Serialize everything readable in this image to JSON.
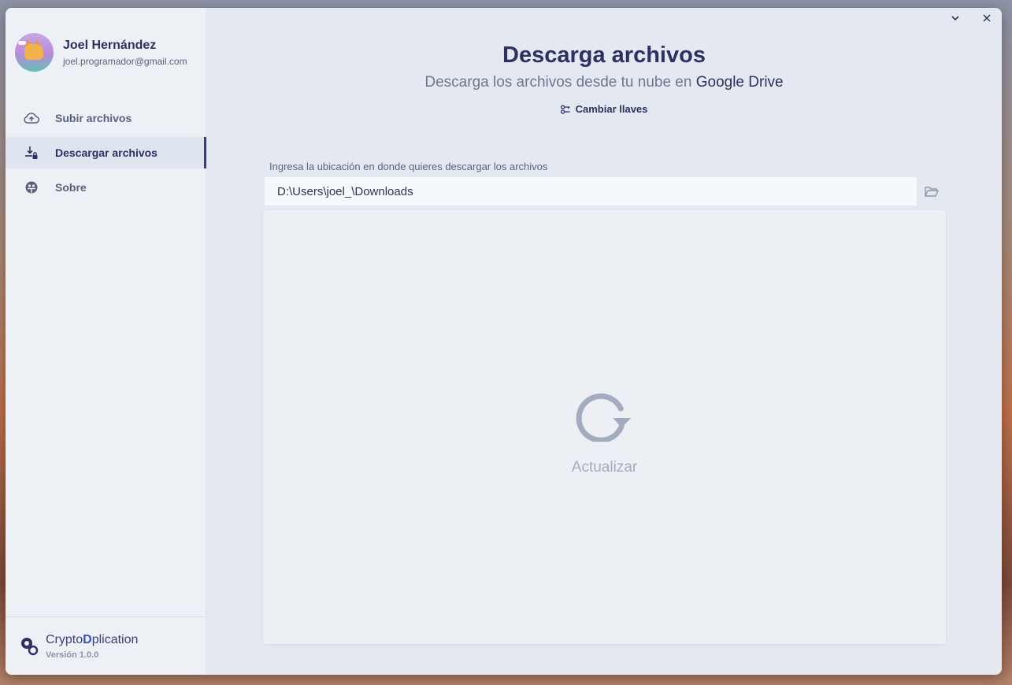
{
  "user": {
    "name": "Joel Hernández",
    "email": "joel.programador@gmail.com"
  },
  "nav": {
    "items": [
      {
        "label": "Subir archivos",
        "icon": "cloud-upload-icon",
        "active": false
      },
      {
        "label": "Descargar archivos",
        "icon": "download-lock-icon",
        "active": true
      },
      {
        "label": "Sobre",
        "icon": "info-face-icon",
        "active": false
      }
    ]
  },
  "brand": {
    "name_prefix": "Crypto",
    "name_highlight": "D",
    "name_suffix": "plication",
    "version": "Versión 1.0.0"
  },
  "main": {
    "title": "Descarga archivos",
    "subtitle_prefix": "Descarga los archivos desde tu nube en ",
    "subtitle_accent": "Google Drive",
    "keys_button": "Cambiar llaves",
    "path_label": "Ingresa la ubicación en donde quieres descargar los archivos",
    "path_value": "D:\\Users\\joel_\\Downloads",
    "refresh_label": "Actualizar"
  },
  "colors": {
    "accent": "#3d3a7a",
    "title": "#2e3160",
    "muted": "#a3acbf",
    "background": "#e4e9f1"
  }
}
